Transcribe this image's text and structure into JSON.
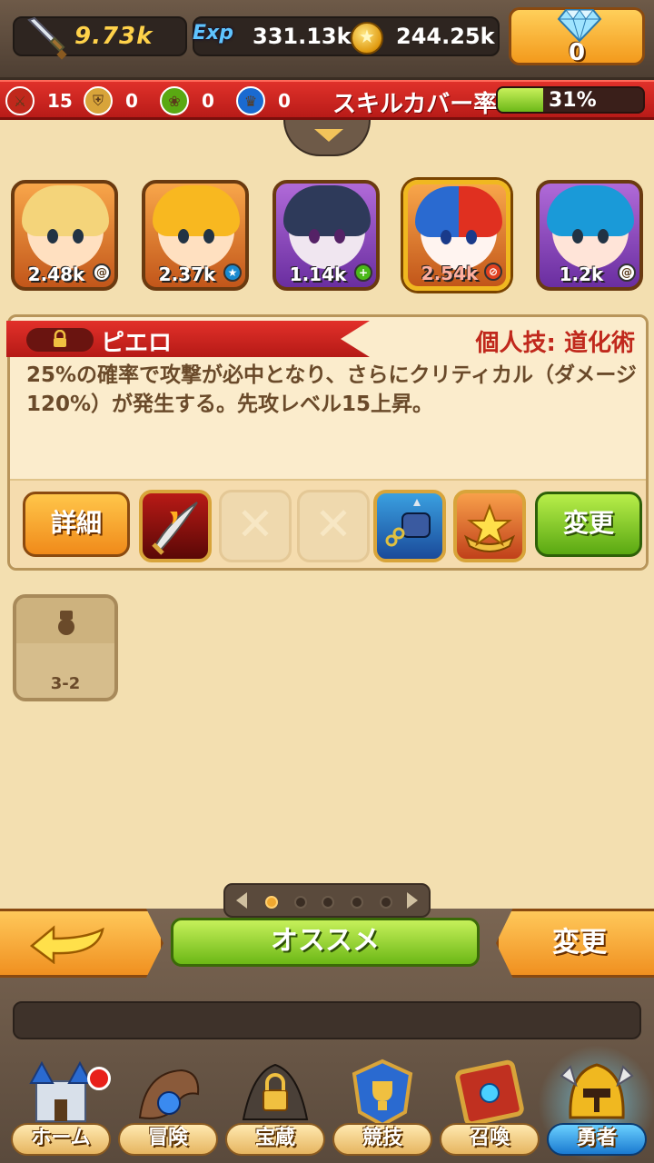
{
  "header": {
    "attack_value": "9.73k",
    "exp_label": "Exp",
    "exp_value": "331.13k",
    "gold_value": "244.25k",
    "gem_count": "0"
  },
  "skill_summary": {
    "items": [
      {
        "icon": "sword-icon",
        "count": "15",
        "color": "#c0281c"
      },
      {
        "icon": "shield-icon",
        "count": "0",
        "color": "#d8a43a"
      },
      {
        "icon": "leaf-icon",
        "count": "0",
        "color": "#5aa812"
      },
      {
        "icon": "crown-icon",
        "count": "0",
        "color": "#1a6ad0"
      }
    ],
    "title": "スキルカバー率",
    "cover_percent": "31%",
    "cover_fraction": 0.31
  },
  "heroes": [
    {
      "power": "2.48k",
      "frame": "orange",
      "badge": "swirl-icon"
    },
    {
      "power": "2.37k",
      "frame": "orange",
      "badge": "star-icon"
    },
    {
      "power": "1.14k",
      "frame": "purple",
      "badge": "plus-icon"
    },
    {
      "power": "2.54k",
      "frame": "orange",
      "badge": "no-icon",
      "selected": true
    },
    {
      "power": "1.2k",
      "frame": "purple",
      "badge": "swirl-icon"
    }
  ],
  "detail": {
    "hero_name": "ピエロ",
    "skill_name": "個人技: 道化術",
    "description": "25%の確率で攻撃が必中となり、さらにクリティカル（ダメージ120%）が発生する。先攻レベル15上昇。",
    "detail_button": "詳細",
    "change_button": "変更",
    "empty_slot_mark": "✕"
  },
  "equipment": {
    "slot_label": "3-2"
  },
  "pager": {
    "pages": 5,
    "active": 0
  },
  "actions": {
    "recommend_label": "オススメ",
    "change_label": "変更"
  },
  "nav": [
    {
      "label": "ホーム",
      "icon": "castle-icon"
    },
    {
      "label": "冒険",
      "icon": "dragon-icon"
    },
    {
      "label": "宝蔵",
      "icon": "treasure-lock-icon"
    },
    {
      "label": "競技",
      "icon": "trophy-icon"
    },
    {
      "label": "召喚",
      "icon": "summon-book-icon"
    },
    {
      "label": "勇者",
      "icon": "hero-helmet-icon"
    }
  ]
}
